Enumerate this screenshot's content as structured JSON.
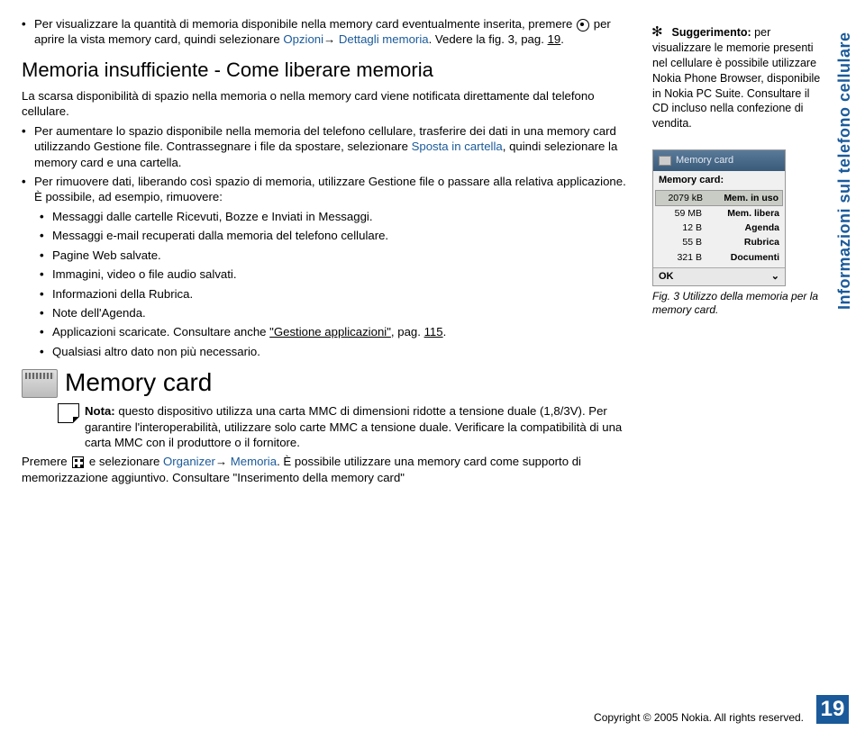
{
  "tab_title": "Informazioni sul telefono cellulare",
  "intro_bullet": {
    "pre": "Per visualizzare la quantità di memoria disponibile nella memory card eventualmente inserita, premere ",
    "post_key": " per aprire la vista memory card, quindi selezionare ",
    "link1": "Opzioni",
    "arrow": "→",
    "link2": "Dettagli memoria",
    "tail": ". Vedere la fig. 3, pag. ",
    "page_ref": "19",
    "end": "."
  },
  "section_title": "Memoria insufficiente - Come liberare memoria",
  "section_intro": "La scarsa disponibilità di spazio nella memoria o nella memory card viene notificata direttamente dal telefono cellulare.",
  "bullets": [
    {
      "pre": "Per aumentare lo spazio disponibile nella memoria del telefono cellulare, trasferire dei dati in una memory card utilizzando Gestione file. Contrassegnare i file da spostare, selezionare ",
      "link": "Sposta in cartella",
      "post": ", quindi selezionare la memory card e una cartella."
    },
    {
      "pre": "Per rimuovere dati, liberando così spazio di memoria, utilizzare Gestione file o passare alla relativa applicazione. È possibile, ad esempio, rimuovere:"
    }
  ],
  "sub_bullets": [
    "Messaggi dalle cartelle Ricevuti, Bozze e Inviati in Messaggi.",
    "Messaggi e-mail recuperati dalla memoria del telefono cellulare.",
    "Pagine Web salvate.",
    "Immagini, video o file audio salvati.",
    "Informazioni della Rubrica.",
    "Note dell'Agenda."
  ],
  "sub_bullet_apps": {
    "pre": "Applicazioni scaricate. Consultare anche ",
    "link": "\"Gestione applicazioni\"",
    "post": ", pag. ",
    "page": "115",
    "end": "."
  },
  "sub_bullet_last": "Qualsiasi altro dato non più necessario.",
  "mc_title": "Memory card",
  "note": {
    "label": "Nota:",
    "text": " questo dispositivo utilizza una carta MMC di dimensioni ridotte a tensione duale (1,8/3V). Per garantire l'interoperabilità, utilizzare solo carte MMC a tensione duale. Verificare la compatibilità di una carta MMC con il produttore o il fornitore."
  },
  "premere": {
    "pre": "Premere ",
    "post": " e selezionare ",
    "link1": "Organizer",
    "arrow": "→",
    "link2": "Memoria",
    "tail": ". È possibile utilizzare una memory card come supporto di memorizzazione aggiuntivo. Consultare \"Inserimento della memory card\""
  },
  "tip": {
    "label": "Suggerimento:",
    "text": " per visualizzare le memorie presenti nel cellulare è possibile utilizzare Nokia Phone Browser, disponibile in Nokia PC Suite. Consultare il CD incluso nella confezione di vendita."
  },
  "phone": {
    "header": "Memory card",
    "label": "Memory card:",
    "rows": [
      {
        "val": "2079 kB",
        "name": "Mem. in uso",
        "highlight": true
      },
      {
        "val": "59 MB",
        "name": "Mem. libera"
      },
      {
        "val": "12 B",
        "name": "Agenda"
      },
      {
        "val": "55 B",
        "name": "Rubrica"
      },
      {
        "val": "321 B",
        "name": "Documenti"
      }
    ],
    "ok": "OK"
  },
  "fig_caption": "Fig. 3 Utilizzo della memoria per la memory card.",
  "copyright": "Copyright © 2005 Nokia. All rights reserved.",
  "page_number": "19"
}
